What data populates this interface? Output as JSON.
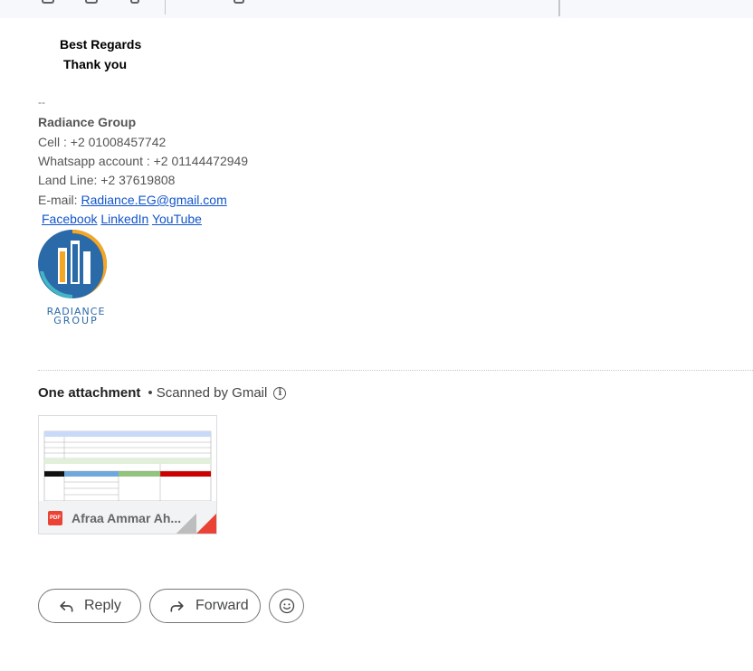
{
  "signature": {
    "greeting": "Best Regards",
    "thanks": "Thank you",
    "dash": "--",
    "company": "Radiance Group",
    "cell": "Cell : +2 01008457742",
    "whatsapp": "Whatsapp account : +2 01144472949",
    "landline": "Land Line: +2 37619808",
    "email_label": "E-mail: ",
    "email": "Radiance.EG@gmail.com",
    "links": {
      "facebook": "Facebook",
      "linkedin": "LinkedIn",
      "youtube": "YouTube"
    },
    "logo": {
      "line1": "RADIANCE",
      "line2": "GROUP"
    }
  },
  "attachments": {
    "title": "One attachment",
    "scanned": "• Scanned by Gmail",
    "items": [
      {
        "name": "Afraa Ammar Ah...",
        "type": "PDF"
      }
    ]
  },
  "actions": {
    "reply": "Reply",
    "forward": "Forward"
  },
  "colors": {
    "link": "#1155cc",
    "pdf": "#ea4335",
    "logo_blue": "#2a6aa8",
    "logo_orange": "#f5a623"
  }
}
